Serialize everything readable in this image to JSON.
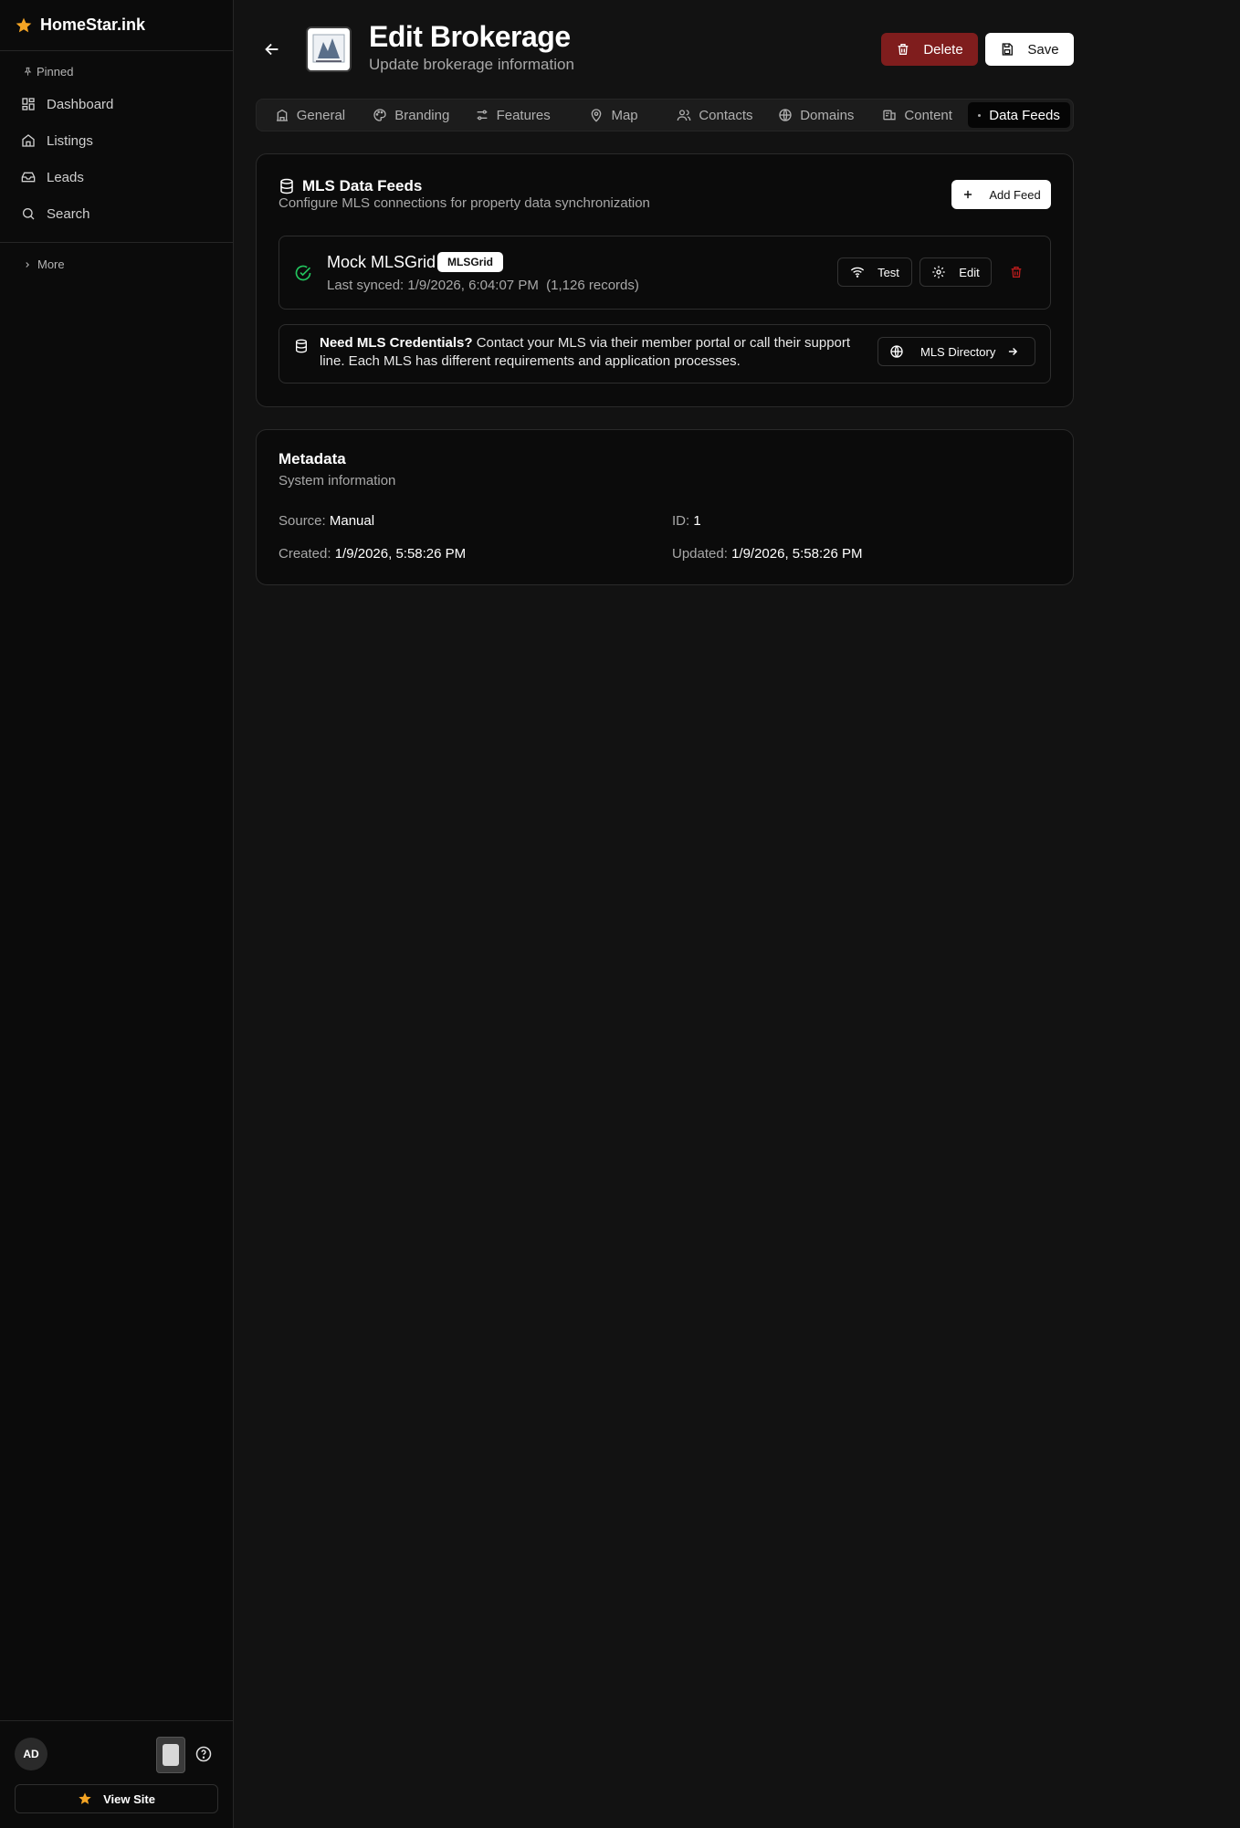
{
  "app": {
    "name": "HomeStar.ink"
  },
  "sidebar": {
    "pinned_label": "Pinned",
    "items": [
      {
        "label": "Dashboard",
        "icon": "dashboard-icon"
      },
      {
        "label": "Listings",
        "icon": "home-icon"
      },
      {
        "label": "Leads",
        "icon": "inbox-icon"
      },
      {
        "label": "Search",
        "icon": "search-icon"
      }
    ],
    "more_label": "More",
    "footer": {
      "avatar_initials": "AD",
      "view_site_label": "View Site"
    }
  },
  "header": {
    "title": "Edit Brokerage",
    "subtitle": "Update brokerage information",
    "delete_label": "Delete",
    "save_label": "Save"
  },
  "tabs": [
    {
      "label": "General",
      "icon": "building-icon"
    },
    {
      "label": "Branding",
      "icon": "palette-icon"
    },
    {
      "label": "Features",
      "icon": "sliders-icon"
    },
    {
      "label": "Map",
      "icon": "map-pin-icon"
    },
    {
      "label": "Contacts",
      "icon": "users-icon"
    },
    {
      "label": "Domains",
      "icon": "globe-icon"
    },
    {
      "label": "Content",
      "icon": "content-icon"
    },
    {
      "label": "Data Feeds",
      "icon": "dot-icon",
      "active": true
    }
  ],
  "feeds_card": {
    "title": "MLS Data Feeds",
    "description": "Configure MLS connections for property data synchronization",
    "add_label": "Add Feed",
    "feed": {
      "name": "Mock MLSGrid",
      "badge": "MLSGrid",
      "sync_text": "Last synced: 1/9/2026, 6:04:07 PM  (1,126 records)",
      "test_label": "Test",
      "edit_label": "Edit",
      "status_color": "#22c55e"
    },
    "notice": {
      "bold": "Need MLS Credentials?",
      "text": " Contact your MLS via their member portal or call their support line. Each MLS has different requirements and application processes.",
      "button_label": "MLS Directory"
    }
  },
  "metadata_card": {
    "title": "Metadata",
    "description": "System information",
    "source_key": "Source:",
    "source_value": "Manual",
    "id_key": "ID:",
    "id_value": "1",
    "created_key": "Created:",
    "created_value": "1/9/2026, 5:58:26 PM",
    "updated_key": "Updated:",
    "updated_value": "1/9/2026, 5:58:26 PM"
  },
  "colors": {
    "accent_star": "#f5a524",
    "danger": "#7f1d1d",
    "trash": "#b91c1c"
  }
}
